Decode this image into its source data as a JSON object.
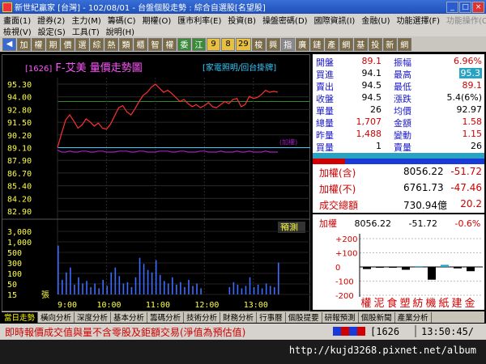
{
  "window": {
    "title": "新世紀贏家 [台灣] - 102/08/01 - 台盤個股走勢 : 綜合自選股[名望股]",
    "buttons": [
      "_",
      "□",
      "×"
    ]
  },
  "menu1": [
    "畫面(1)",
    "證券(2)",
    "主力(M)",
    "籌碼(C)",
    "期權(O)",
    "匯市利率(E)",
    "投資(B)",
    "操盤密碼(D)",
    "國際資訊(I)",
    "金融(U)",
    "功能選擇(F)"
  ],
  "menu1_right": "功能操作(C)",
  "menu2": [
    "檢視(V)",
    "設定(S)",
    "工具(T)",
    "說明(H)"
  ],
  "toolbar": {
    "items": [
      {
        "label": "◀",
        "style": "ar"
      },
      {
        "label": "加",
        "style": "dk"
      },
      {
        "label": "權",
        "style": "dk"
      },
      {
        "label": "期",
        "style": "dk"
      },
      {
        "label": "價",
        "style": "dk"
      },
      {
        "label": "選",
        "style": "dk"
      },
      {
        "label": "綜",
        "style": "dk"
      },
      {
        "label": "熱",
        "style": "dk"
      },
      {
        "label": "類",
        "style": "dk"
      },
      {
        "label": "櫃",
        "style": "dk"
      },
      {
        "label": "智",
        "style": "dk"
      },
      {
        "label": "權",
        "style": "dk"
      },
      {
        "label": "委",
        "style": "gn"
      },
      {
        "label": "江",
        "style": "gn"
      },
      {
        "label": "9",
        "style": "yl"
      },
      {
        "label": "8",
        "style": "yl"
      },
      {
        "label": "29",
        "style": "yl"
      },
      {
        "label": "梭",
        "style": "dk"
      },
      {
        "label": "興",
        "style": "dk"
      },
      {
        "label": "指",
        "style": "gy"
      },
      {
        "label": "廣",
        "style": "dk"
      },
      {
        "label": "鏈",
        "style": "dk"
      },
      {
        "label": "產",
        "style": "dk"
      },
      {
        "label": "網",
        "style": "dk"
      },
      {
        "label": "基",
        "style": "dk"
      },
      {
        "label": "投",
        "style": "dk"
      },
      {
        "label": "新",
        "style": "dk"
      },
      {
        "label": "網",
        "style": "dk"
      }
    ]
  },
  "chart_header": {
    "code": "[1626]",
    "name": "F-艾美",
    "title": "量價走勢圖",
    "links": "[家電照明/回台掛牌]"
  },
  "chart_data": {
    "type": "line",
    "title": "量價走勢圖",
    "price_ticks": [
      "95.30",
      "94.00",
      "92.80",
      "91.50",
      "90.20",
      "89.10",
      "87.90",
      "86.70",
      "85.40",
      "84.20",
      "82.90"
    ],
    "ref_price": 89.1,
    "ref_label": "(加權)",
    "volume_ticks": [
      "3,000",
      "1,000",
      "500",
      "300",
      "100",
      "50",
      "15"
    ],
    "volume_unit": "張",
    "time_labels": [
      "9:00",
      "10:00",
      "11:00",
      "12:00",
      "13:00"
    ],
    "estimate_label": "預測",
    "price_series": {
      "name": "成交價",
      "x": [
        "9:00",
        "9:05",
        "9:10",
        "9:15",
        "9:20",
        "9:25",
        "9:30",
        "9:35",
        "9:40",
        "9:45",
        "9:50",
        "9:55",
        "10:00",
        "10:05",
        "10:10",
        "10:15",
        "10:20",
        "10:25",
        "10:30",
        "10:35",
        "10:40",
        "10:45",
        "10:50",
        "10:55",
        "11:00",
        "11:05",
        "11:10",
        "11:15",
        "11:20",
        "11:25",
        "11:30",
        "11:35",
        "11:40",
        "11:45",
        "11:50",
        "11:55",
        "12:00",
        "12:05",
        "12:10",
        "12:15",
        "12:20",
        "12:25",
        "12:30",
        "12:35",
        "12:40",
        "12:45",
        "12:50",
        "12:55",
        "13:00",
        "13:05",
        "13:10",
        "13:15",
        "13:20",
        "13:25",
        "13:30"
      ],
      "values": [
        89.1,
        90.5,
        91.8,
        92.3,
        91.7,
        91.0,
        91.3,
        91.9,
        91.6,
        91.2,
        91.5,
        91.0,
        90.9,
        91.4,
        92.2,
        93.0,
        93.2,
        92.6,
        92.3,
        92.9,
        93.6,
        94.2,
        94.5,
        95.0,
        95.3,
        94.9,
        94.5,
        94.7,
        94.4,
        94.0,
        93.6,
        93.8,
        93.4,
        93.1,
        93.3,
        93.0,
        93.2,
        93.5,
        93.1,
        93.0,
        93.3,
        93.6,
        93.4,
        93.8,
        93.9,
        93.1,
        93.3,
        94.1,
        93.9,
        94.0,
        94.3,
        94.7,
        94.5,
        94.6,
        94.5
      ]
    },
    "index_series": {
      "name": "加權",
      "values": [
        89.1,
        88.9,
        88.9,
        89.0,
        88.9,
        88.9,
        89.0,
        89.0,
        88.9,
        88.9,
        89.0,
        89.0,
        88.9,
        88.9,
        88.9,
        89.0,
        89.0,
        89.0,
        88.9,
        88.9,
        89.0,
        89.0,
        88.9,
        88.9,
        88.9,
        89.0,
        89.0,
        89.0,
        88.9,
        88.9,
        89.0,
        89.0,
        88.9,
        88.9,
        88.9,
        89.0,
        89.0,
        88.9,
        88.9,
        88.9,
        89.0,
        88.9,
        88.9,
        88.9,
        89.0,
        88.9,
        88.9,
        89.0,
        88.9,
        88.9,
        88.9,
        89.0,
        88.9,
        88.9,
        88.9
      ]
    },
    "volume_series": {
      "name": "成交量",
      "values": [
        40,
        12,
        18,
        22,
        8,
        14,
        9,
        11,
        6,
        9,
        5,
        12,
        7,
        18,
        22,
        15,
        9,
        10,
        6,
        14,
        30,
        25,
        20,
        18,
        28,
        16,
        11,
        9,
        14,
        8,
        10,
        6,
        12,
        7,
        9,
        5,
        0,
        0,
        0,
        0,
        0,
        0,
        6,
        10,
        8,
        5,
        7,
        14,
        6,
        8,
        5,
        9,
        7,
        6,
        26
      ]
    }
  },
  "quote": {
    "rows": [
      {
        "l1": "開盤",
        "v1": "89.1",
        "c1": "red",
        "l2": "振幅",
        "v2": "6.96%",
        "c2": "red"
      },
      {
        "l1": "買進",
        "v1": "94.1",
        "c1": "blk",
        "l2": "最高",
        "v2": "95.3",
        "c2": "hl"
      },
      {
        "l1": "賣出",
        "v1": "94.5",
        "c1": "blk",
        "l2": "最低",
        "v2": "89.1",
        "c2": "red"
      },
      {
        "l1": "收盤",
        "v1": "94.5",
        "c1": "blk",
        "l2": "漲跌",
        "v2": "5.4(6%)",
        "c2": "blk"
      },
      {
        "l1": "單量",
        "v1": "26",
        "c1": "blk",
        "l2": "均價",
        "v2": "92.97",
        "c2": "blk"
      },
      {
        "l1": "總量",
        "v1": "1,707",
        "c1": "red",
        "l2": "金額",
        "v2": "1.58",
        "c2": "red"
      },
      {
        "l1": "昨量",
        "v1": "1,488",
        "c1": "red",
        "l2": "變動",
        "v2": "1.15",
        "c2": "red"
      },
      {
        "l1": "買量",
        "v1": "1",
        "c1": "blk",
        "l2": "賣量",
        "v2": "26",
        "c2": "blk"
      }
    ]
  },
  "index": {
    "rows": [
      {
        "label": "加權(含)",
        "value": "8056.22",
        "change": "-51.72"
      },
      {
        "label": "加權(不)",
        "value": "6761.73",
        "change": "-47.46"
      },
      {
        "label": "成交總額",
        "value": "730.94億",
        "change": "20.2"
      }
    ]
  },
  "sector": {
    "head": [
      "加權",
      "8056.22",
      "-51.72",
      "-0.6%"
    ],
    "yticks": [
      "+200",
      "+100",
      "0",
      "-100",
      "-200"
    ],
    "names": [
      "權",
      "泥",
      "食",
      "塑",
      "紡",
      "機",
      "紙",
      "建",
      "金"
    ],
    "values": [
      -15,
      -5,
      -5,
      -20,
      5,
      -90,
      15,
      -10,
      -30
    ],
    "colors": [
      "#000",
      "#000",
      "#000",
      "#000",
      "#29a3c3",
      "#000",
      "#29a3c3",
      "#000",
      "#000"
    ]
  },
  "tabs": [
    "當日走勢",
    "橫向分析",
    "深度分析",
    "基本分析",
    "籌碼分析",
    "技術分析",
    "財務分析",
    "行事曆",
    "個股提要",
    "研報預測",
    "個股新聞",
    "產業分析"
  ],
  "status": {
    "notice": "即時報價成交值與量不含零股及鉅額交易(淨值為預估值)",
    "code": "[1626",
    "time": "13:50:45/"
  },
  "footer": {
    "url": "http://kujd3268.pixnet.net/album"
  }
}
